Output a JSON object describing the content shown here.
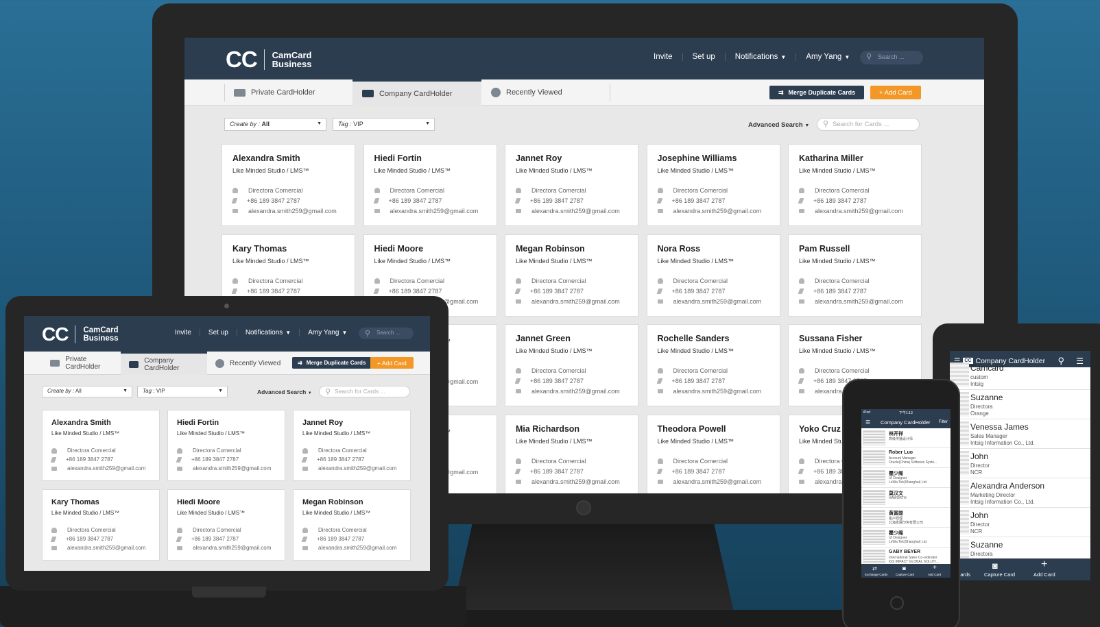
{
  "brand": {
    "logo": "CC",
    "name_line1": "CamCard",
    "name_line2": "Business"
  },
  "nav": {
    "invite": "Invite",
    "setup": "Set up",
    "notifications": "Notifications",
    "user": "Amy Yang",
    "search_placeholder": "Search ..."
  },
  "tabs": {
    "private": "Private CardHolder",
    "company": "Company CardHolder",
    "recent": "Recently Viewed"
  },
  "actions": {
    "merge": "Merge Duplicate Cards",
    "add": "+ Add Card"
  },
  "filters": {
    "create_label": "Create by :",
    "create_value": "All",
    "tag_label": "Tag :",
    "tag_value": "VIP",
    "advanced": "Advanced Search",
    "search_placeholder": "Search for Cards ..."
  },
  "card_defaults": {
    "company": "Like Minded Studio / LMS™",
    "title": "Directora Comercial",
    "phone": "+86 189 3847 2787",
    "email": "alexandra.smith259@gmail.com"
  },
  "cards": [
    {
      "name": "Alexandra Smith"
    },
    {
      "name": "Hiedi Fortin"
    },
    {
      "name": "Jannet Roy"
    },
    {
      "name": "Josephine Williams"
    },
    {
      "name": "Katharina Miller"
    },
    {
      "name": "Kary Thomas"
    },
    {
      "name": "Hiedi Moore"
    },
    {
      "name": "Megan Robinson"
    },
    {
      "name": "Nora Ross"
    },
    {
      "name": "Pam Russell"
    },
    {
      "name": ""
    },
    {
      "name": ""
    },
    {
      "name": "Jannet Green"
    },
    {
      "name": "Rochelle Sanders"
    },
    {
      "name": "Sussana Fisher"
    },
    {
      "name": ""
    },
    {
      "name": ""
    },
    {
      "name": "Mia Richardson"
    },
    {
      "name": "Theodora Powell"
    },
    {
      "name": "Yoko Cruz"
    }
  ],
  "laptop_cards": [
    {
      "name": "Alexandra Smith"
    },
    {
      "name": "Hiedi Fortin"
    },
    {
      "name": "Jannet Roy"
    },
    {
      "name": "Kary Thomas"
    },
    {
      "name": "Hiedi Moore"
    },
    {
      "name": "Megan Robinson"
    }
  ],
  "tablet": {
    "title": "Company CardHolder",
    "items": [
      {
        "name": "Camcard",
        "l1": "custom",
        "l2": "Intsig"
      },
      {
        "name": "Suzanne",
        "l1": "Directora",
        "l2": "Orange"
      },
      {
        "name": "Venessa James",
        "l1": "Sales Manager",
        "l2": "Intsig Information Co., Ltd."
      },
      {
        "name": "John",
        "l1": "Director",
        "l2": "NCR"
      },
      {
        "name": "Alexandra Anderson",
        "l1": "Marketing Director",
        "l2": "Intsig Information Co., Ltd."
      },
      {
        "name": "John",
        "l1": "Director",
        "l2": "NCR"
      },
      {
        "name": "Suzanne",
        "l1": "Directora",
        "l2": "Orange"
      }
    ],
    "bottom": {
      "cards": "Cards",
      "capture": "Capture Card",
      "add": "Add Card"
    }
  },
  "phone": {
    "status_left": "iPod",
    "status_time": "下午1:13",
    "title": "Company CardHolder",
    "filter": "Filter",
    "items": [
      {
        "name": "林开祥",
        "l1": "高级传播设计师",
        "l2": ""
      },
      {
        "name": "Rober  Luo",
        "l1": "Account Manager",
        "l2": "Oracle(China) Software Syste..."
      },
      {
        "name": "瞿少阁",
        "l1": "UI Designer",
        "l2": "LeWa Tek(Shanghai) Ltd."
      },
      {
        "name": "莫汉文",
        "l1": "HAWORTH",
        "l2": ""
      },
      {
        "name": "黄富勋",
        "l1": "客户经理",
        "l2": "北海发展印务有限公司"
      },
      {
        "name": "瞿少阁",
        "l1": "UI Designer",
        "l2": "LeWa Tek(Shanghai) Ltd."
      },
      {
        "name": "GABY  BEYER",
        "l1": "International Sales Co-ordinator",
        "l2": "iGS IMPACT GLOBAL SOLUTI..."
      }
    ],
    "bottom": {
      "exchange": "Exchange Cards",
      "capture": "Capture Card",
      "add": "Add Card"
    }
  },
  "colors": {
    "header": "#2c3d50",
    "accent": "#f39826",
    "background": "#1f5a7c"
  }
}
